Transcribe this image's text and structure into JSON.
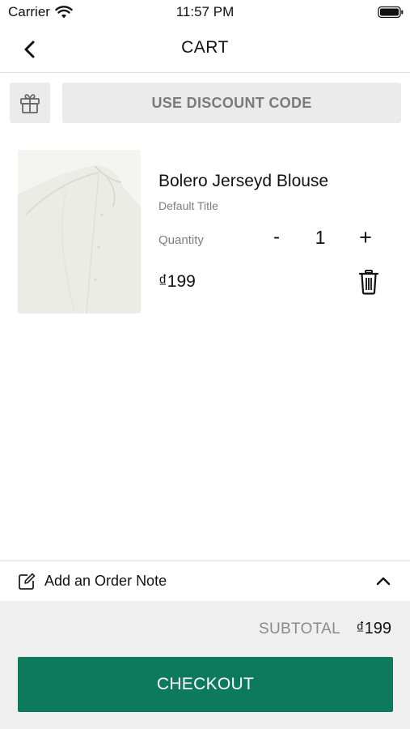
{
  "status_bar": {
    "carrier": "Carrier",
    "time": "11:57 PM"
  },
  "nav": {
    "title": "CART",
    "back_icon": "chevron-left-icon"
  },
  "discount": {
    "gift_icon": "gift-icon",
    "label": "USE DISCOUNT CODE"
  },
  "cart": {
    "items": [
      {
        "name": "Bolero Jerseyd Blouse",
        "variant": "Default Title",
        "quantity_label": "Quantity",
        "minus": "-",
        "quantity": "1",
        "plus": "+",
        "price": "₫199",
        "delete_icon": "trash-icon"
      }
    ]
  },
  "order_note": {
    "icon": "edit-note-icon",
    "label": "Add an Order Note",
    "toggle_icon": "chevron-up-icon"
  },
  "footer": {
    "subtotal_label": "SUBTOTAL",
    "subtotal_value": "₫199",
    "checkout_label": "CHECKOUT"
  },
  "colors": {
    "accent": "#0d7a5e",
    "button_gray": "#ebebeb",
    "footer_bg": "#efefef",
    "muted_text": "#7d7d7d"
  }
}
